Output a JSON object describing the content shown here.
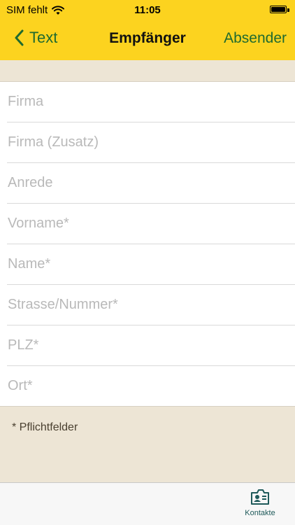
{
  "status_bar": {
    "carrier": "SIM fehlt",
    "time": "11:05",
    "battery_level": 1.0
  },
  "navbar": {
    "back_label": "Text",
    "title": "Empfänger",
    "right_label": "Absender"
  },
  "form": {
    "fields": [
      {
        "placeholder": "Firma",
        "value": ""
      },
      {
        "placeholder": "Firma (Zusatz)",
        "value": ""
      },
      {
        "placeholder": "Anrede",
        "value": ""
      },
      {
        "placeholder": "Vorname*",
        "value": ""
      },
      {
        "placeholder": "Name*",
        "value": ""
      },
      {
        "placeholder": "Strasse/Nummer*",
        "value": ""
      },
      {
        "placeholder": "PLZ*",
        "value": ""
      },
      {
        "placeholder": "Ort*",
        "value": ""
      }
    ]
  },
  "note": "* Pflichtfelder",
  "tabbar": {
    "tabs": [
      {
        "label": "Kontakte",
        "icon": "contact-card-icon"
      }
    ]
  },
  "colors": {
    "header": "#fcd31f",
    "accent": "#1f6a2f",
    "background": "#ede5d5",
    "tab_accent": "#1f5a5a"
  }
}
